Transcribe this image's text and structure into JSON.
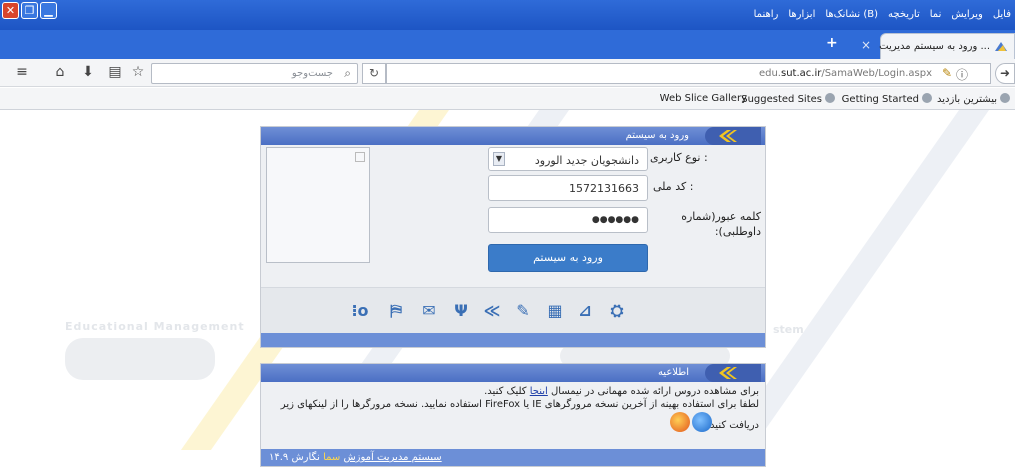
{
  "browser": {
    "menu": [
      "فایل",
      "ویرایش",
      "نما",
      "تاریخچه",
      "نشانک‌ها (B)",
      "ابزارها",
      "راهنما"
    ],
    "tab_title": "ورود به سیستم مدیریت ...",
    "tab_close": "×",
    "new_tab": "+",
    "search_placeholder": "جست‌وجو",
    "url_prefix": "edu.",
    "url_domain": "sut.ac.ir",
    "url_path": "/SamaWeb/Login.aspx",
    "bookmarks": [
      "بیشترین بازدید",
      "Getting Started",
      "Suggested Sites",
      "Web Slice Gallery"
    ]
  },
  "login_panel": {
    "title": "ورود به سیستم",
    "user_type_label": "نوع کاربری :",
    "user_type_value": "دانشجویان جدید الورود",
    "national_code_label": "کد ملی :",
    "national_code_value": "1572131663",
    "password_label": "کلمه عبور(شماره داوطلبی):",
    "password_value": "●●●●●●",
    "login_button": "ورود به سیستم"
  },
  "watermark": {
    "left_text": "Educational Management",
    "right_text": "stem"
  },
  "info_panel": {
    "title": "اطلاعیه",
    "line1_pre": "برای مشاهده دروس ارائه شده مهمانی در نیمسال ",
    "line1_link": "اینجا",
    "line1_post": " کلیک کنید.",
    "line2": "لطفا برای استفاده بهینه از آخرین نسخه مرورگرهای IE یا FireFox استفاده نمایید. نسخه مرورگرها را از لینکهای زیر",
    "line3": "دریافت کنید.",
    "footer_link": "سیستم مدیریت آموزش",
    "footer_brand": "سما",
    "footer_version": "نگارش ۱۴.۹"
  }
}
